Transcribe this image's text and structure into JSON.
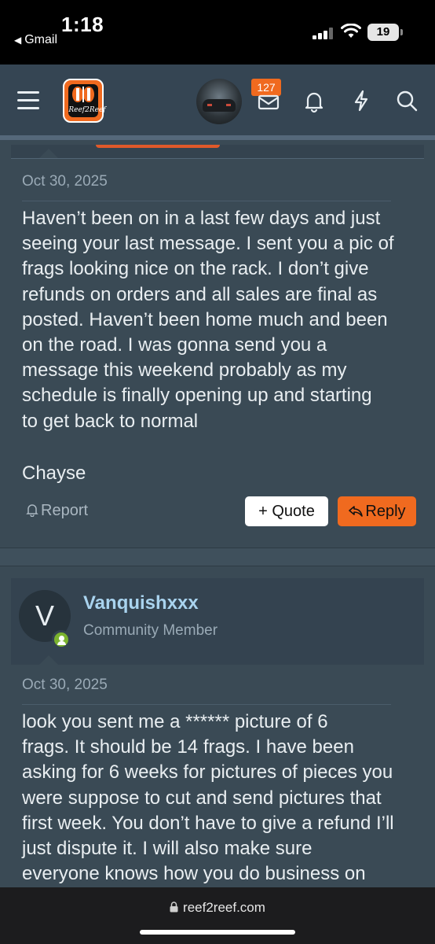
{
  "status": {
    "time": "1:18",
    "back_label": "Gmail",
    "battery": "19"
  },
  "header": {
    "notifications_count": "127",
    "logo_text": "Reef2Reef"
  },
  "post1": {
    "date": "Oct 30, 2025",
    "lines": [
      "Haven’t been on in a last few days and just",
      "seeing your last message. I sent you a pic of",
      "frags looking nice on the rack. I don’t give",
      "refunds on orders and all sales are final as",
      "posted. Haven’t been home much and been",
      "on the road. I was gonna send you a",
      "message this weekend probably as my",
      "schedule is finally opening up and starting",
      "to get back to normal"
    ],
    "signature": "Chayse",
    "report_label": "Report",
    "quote_label": "+ Quote",
    "reply_label": "Reply"
  },
  "post2": {
    "avatar_letter": "V",
    "author": "Vanquishxxx",
    "role": "Community Member",
    "date": "Oct 30, 2025",
    "lines": [
      "look you sent me a ****** picture of 6",
      "frags. It should be 14 frags. I have been",
      "asking for 6 weeks for pictures of pieces you",
      "were suppose to cut and send pictures that",
      "first week. You don’t have to give a refund I’ll",
      "just dispute it. I will also make sure",
      "everyone knows how you do business on"
    ]
  },
  "browser": {
    "url": "reef2reef.com"
  },
  "colors": {
    "accent": "#f06a1f",
    "username": "#a9d3ee",
    "online": "#7bb32e"
  }
}
